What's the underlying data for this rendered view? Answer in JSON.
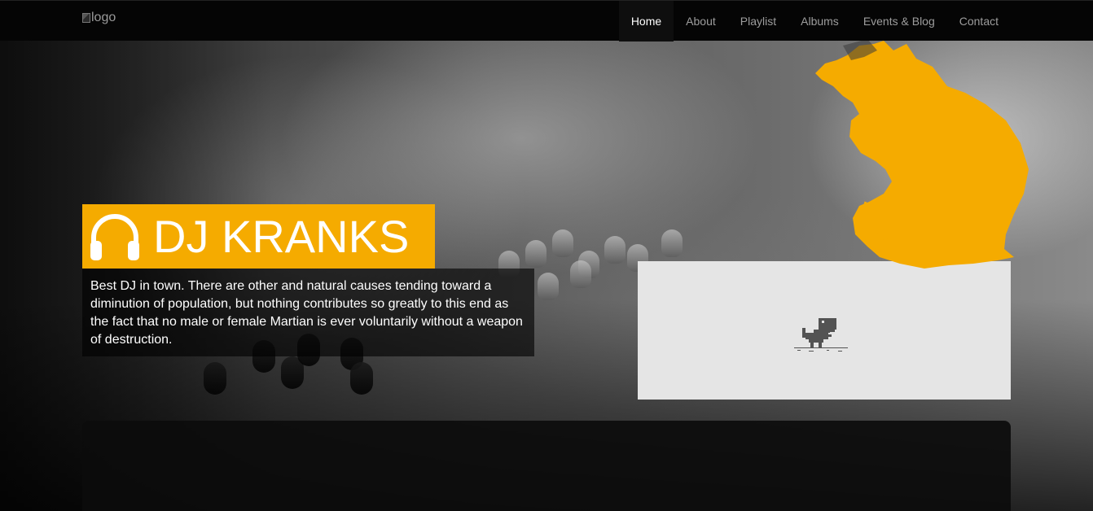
{
  "header": {
    "logo_alt": "logo",
    "nav": [
      {
        "label": "Home",
        "active": true
      },
      {
        "label": "About",
        "active": false
      },
      {
        "label": "Playlist",
        "active": false
      },
      {
        "label": "Albums",
        "active": false
      },
      {
        "label": "Events & Blog",
        "active": false
      },
      {
        "label": "Contact",
        "active": false
      }
    ]
  },
  "hero": {
    "icon": "headphones-icon",
    "title": "DJ KRANKS",
    "description": "Best DJ in town. There are other and natural causes tending toward a diminution of population, but nothing contributes so greatly to this end as the fact that no male or female Martian is ever voluntarily without a weapon of destruction."
  },
  "embed": {
    "icon": "dinosaur-icon"
  },
  "colors": {
    "accent": "#f5ab00",
    "navbar": "#050505",
    "embed_bg": "#e5e5e5",
    "panel_bg": "#0c0c0c"
  }
}
